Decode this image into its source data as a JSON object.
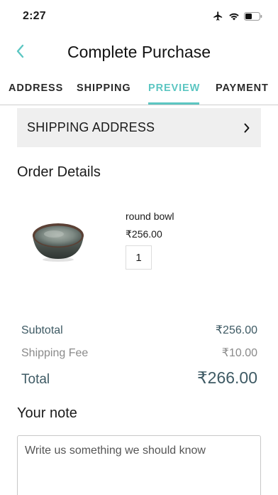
{
  "status_bar": {
    "time": "2:27"
  },
  "header": {
    "title": "Complete Purchase",
    "back_icon": "chevron-left-icon"
  },
  "steps": [
    {
      "label": "ADDRESS",
      "active": false
    },
    {
      "label": "SHIPPING",
      "active": false
    },
    {
      "label": "PREVIEW",
      "active": true
    },
    {
      "label": "PAYMENT",
      "active": false
    }
  ],
  "shipping_address": {
    "label": "SHIPPING ADDRESS",
    "icon": "chevron-right-icon"
  },
  "order": {
    "title": "Order Details",
    "items": [
      {
        "name": "round bowl",
        "price": "₹256.00",
        "quantity": "1",
        "image_icon": "bowl-image"
      }
    ]
  },
  "summary": {
    "subtotal_label": "Subtotal",
    "subtotal_value": "₹256.00",
    "shipping_label": "Shipping Fee",
    "shipping_value": "₹10.00",
    "total_label": "Total",
    "total_value": "₹266.00"
  },
  "note": {
    "title": "Your note",
    "placeholder": "Write us something we should know"
  },
  "colors": {
    "accent": "#5cc6c2",
    "summary_text": "#3e5a64",
    "muted_text": "#8a8a8a",
    "panel_bg": "#efefef"
  }
}
